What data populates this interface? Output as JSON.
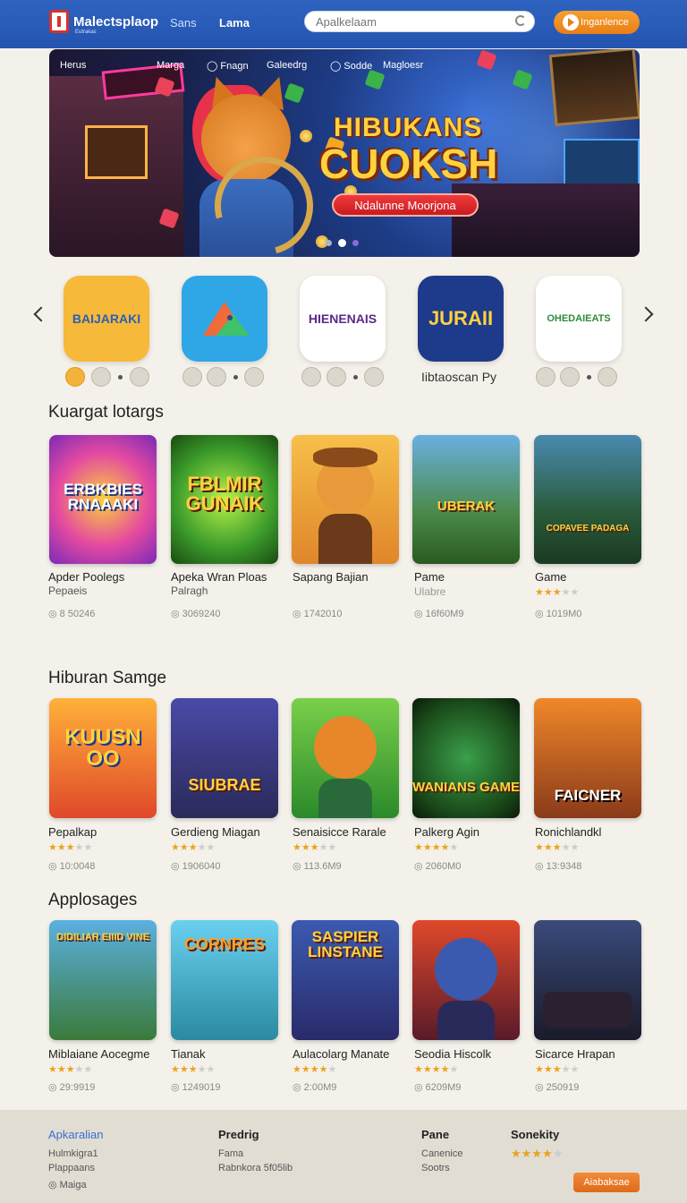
{
  "header": {
    "brand": "Malectsplaop",
    "brand_sub": "Eutrakas",
    "nav": [
      "Sans",
      "Lama"
    ],
    "search_placeholder": "Apalkelaam",
    "cta": "Inganlence"
  },
  "hero": {
    "nav": [
      "Herus",
      "Marga",
      "Fnagn",
      "Galeedrg",
      "Sodde",
      "Magloesr"
    ],
    "title_line1": "HIBUKANS",
    "title_line2": "CUOKSH",
    "button": "Ndalunne Moorjona",
    "slide_count": 3,
    "active_slide": 1
  },
  "featured": {
    "apps": [
      {
        "label": "BAIJARAKI",
        "bg": "#f7b93a",
        "fg": "#2b5fb5"
      },
      {
        "label": "",
        "bg": "#2fa6e6",
        "fg": "#fff"
      },
      {
        "label": "HIENENAIS",
        "bg": "#ffffff",
        "fg": "#5a2a88"
      },
      {
        "label": "JURAII",
        "bg": "#1e3a8a",
        "fg": "#ffd23f"
      },
      {
        "label": "OHEDAIEATS",
        "bg": "#ffffff",
        "fg": "#2f8a3a"
      }
    ],
    "caption": "Iibtaoscan Py"
  },
  "sections": [
    {
      "title": "Kuargat lotargs",
      "items": [
        {
          "img_text": "ERBKBIES RNAAAKI",
          "title": "Apder Poolegs",
          "sub": "Pepaeis",
          "meta": "8 50246",
          "rating": 0
        },
        {
          "img_text": "FBLMIR GUNAIK",
          "title": "Apeka Wran Ploas",
          "sub": "Palragh",
          "meta": "3069240",
          "rating": 0
        },
        {
          "img_text": "",
          "title": "Sapang Bajian",
          "sub": "",
          "meta": "1742010",
          "rating": 0
        },
        {
          "img_text": "UBERAK",
          "title": "Pame",
          "sub": "Ulabre",
          "meta": "16f60M9",
          "rating": 0
        },
        {
          "img_text": "COPAVEE PADAGA",
          "title": "Game",
          "sub": "",
          "meta": "1019M0",
          "rating": 3
        }
      ]
    },
    {
      "title": "Hiburan Samge",
      "items": [
        {
          "img_text": "KUUSN OO",
          "title": "Pepalkap",
          "meta": "10:0048",
          "rating": 3
        },
        {
          "img_text": "SIUBRAE",
          "title": "Gerdieng Miagan",
          "meta": "1906040",
          "rating": 3
        },
        {
          "img_text": "",
          "title": "Senaisicce Rarale",
          "meta": "113.6M9",
          "rating": 3
        },
        {
          "img_text": "WANIANS GAME",
          "title": "Palkerg Agin",
          "meta": "2060M0",
          "rating": 4
        },
        {
          "img_text": "FAICNER",
          "title": "Ronichlandkl",
          "meta": "13:9348",
          "rating": 3
        }
      ]
    },
    {
      "title": "Applosages",
      "items": [
        {
          "img_text": "DIDILIAR EIIID VINE",
          "title": "Miblaiane Aocegme",
          "meta": "29:9919",
          "rating": 3
        },
        {
          "img_text": "CORNRES",
          "title": "Tianak",
          "meta": "1249019",
          "rating": 3
        },
        {
          "img_text": "SASPIER LINSTANE",
          "title": "Aulacolarg Manate",
          "meta": "2:00M9",
          "rating": 4
        },
        {
          "img_text": "",
          "title": "Seodia Hiscolk",
          "meta": "6209M9",
          "rating": 4
        },
        {
          "img_text": "",
          "title": "Sicarce Hrapan",
          "meta": "250919",
          "rating": 3
        }
      ]
    }
  ],
  "footer": {
    "col1": {
      "title": "Apkaralian",
      "items": [
        "Hulmkigra1",
        "Plappaans",
        "Maiga"
      ]
    },
    "col2": {
      "title": "Predrig",
      "items": [
        "Fama",
        "Rabnkora 5f05lib"
      ]
    },
    "col3": {
      "title": "Pane",
      "items": [
        "Canenice",
        "Sootrs"
      ]
    },
    "col4": {
      "title": "Sonekity",
      "rating": 4
    },
    "button": "Aiabaksae"
  }
}
